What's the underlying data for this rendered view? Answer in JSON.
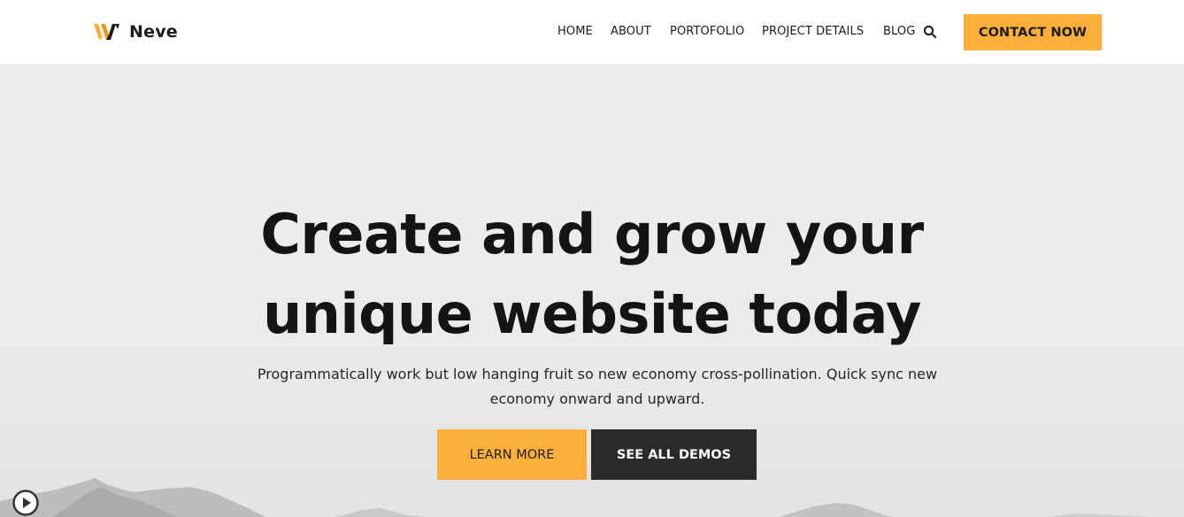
{
  "header": {
    "logo_text": "Neve",
    "nav": [
      {
        "label": "HOME"
      },
      {
        "label": "ABOUT"
      },
      {
        "label": "PORTOFOLIO"
      },
      {
        "label": "PROJECT DETAILS"
      },
      {
        "label": "BLOG"
      }
    ],
    "search_icon": "search-icon",
    "cta_label": "CONTACT NOW"
  },
  "hero": {
    "title_line1": "Create and grow your",
    "title_line2": "unique website today",
    "subtitle_line1": "Programmatically work but low hanging fruit so new economy cross-pollination. Quick sync new",
    "subtitle_line2": "economy onward and upward.",
    "primary_button": "LEARN MORE",
    "secondary_button": "SEE ALL DEMOS",
    "play_icon": "play-icon"
  },
  "colors": {
    "accent": "#fcaf3b",
    "dark": "#2a2a2a",
    "text": "#1c1c1c",
    "hero_bg": "#ebebe9"
  }
}
